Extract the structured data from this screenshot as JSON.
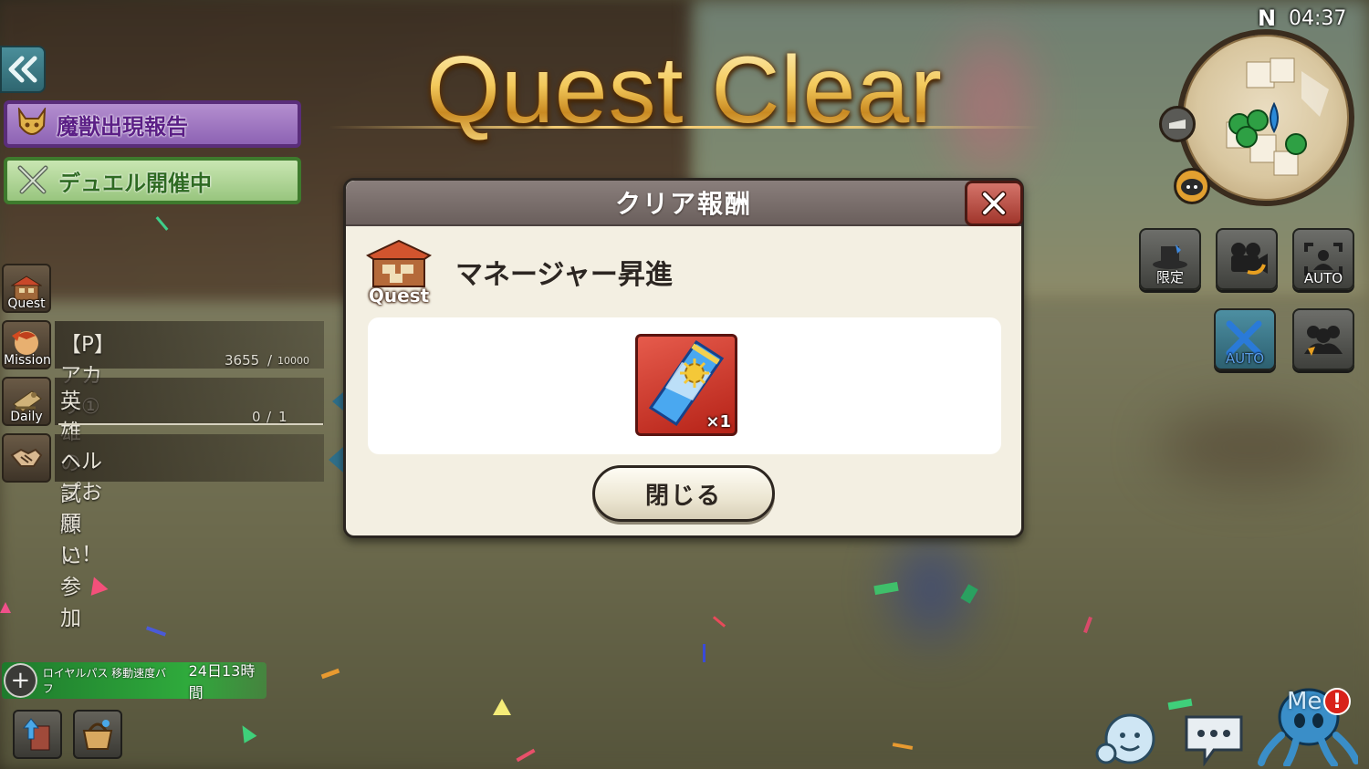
{
  "title": "Quest Clear",
  "clock": "04:37",
  "compass_label": "N",
  "left_panel": {
    "banners": [
      {
        "label": "魔獣出現報告",
        "icon": "demon-mask-icon"
      },
      {
        "label": "デュエル開催中",
        "icon": "crossed-swords-icon"
      }
    ],
    "rows": [
      {
        "tag": "Quest",
        "text": "",
        "icon": "quest-house-icon"
      },
      {
        "tag": "Mission",
        "text": "【P】アカリ①",
        "progress_current": "3655",
        "progress_sep": "/",
        "progress_total": "10000",
        "icon": "mission-portrait-icon"
      },
      {
        "tag": "Daily",
        "text": "英雄の試練に参加",
        "progress_current": "0",
        "progress_sep": "/",
        "progress_total": "1",
        "icon": "daily-scroll-icon"
      },
      {
        "tag": "",
        "text": "ヘルプお願い！",
        "icon": "handshake-icon"
      }
    ]
  },
  "right_tools": [
    {
      "label": "限定",
      "icon": "magician-hat-icon"
    },
    {
      "label": "",
      "icon": "video-camera-icon"
    },
    {
      "label": "AUTO",
      "icon": "auto-target-icon"
    },
    {
      "label": "AUTO",
      "icon": "auto-sword-icon"
    },
    {
      "label": "",
      "icon": "party-members-icon"
    }
  ],
  "dialog": {
    "title": "クリア報酬",
    "quest_tag": "Quest",
    "quest_name": "マネージャー昇進",
    "reward": {
      "name": "ticket",
      "quantity": "×1",
      "icon": "sun-ticket-icon"
    },
    "close_button": "閉じる"
  },
  "buff": {
    "name": "ロイヤルパス 移動速度バフ",
    "time": "24日13時間"
  },
  "bottom_right": {
    "me_label": "Me",
    "alert": "!"
  },
  "colors": {
    "title_gold": "#f3c95b",
    "dialog_header": "#7a6f6c",
    "close_red": "#b84a3f",
    "monster_banner": "#8d63b4",
    "duel_banner": "#98c57e",
    "buff_green": "#2faa3c"
  }
}
